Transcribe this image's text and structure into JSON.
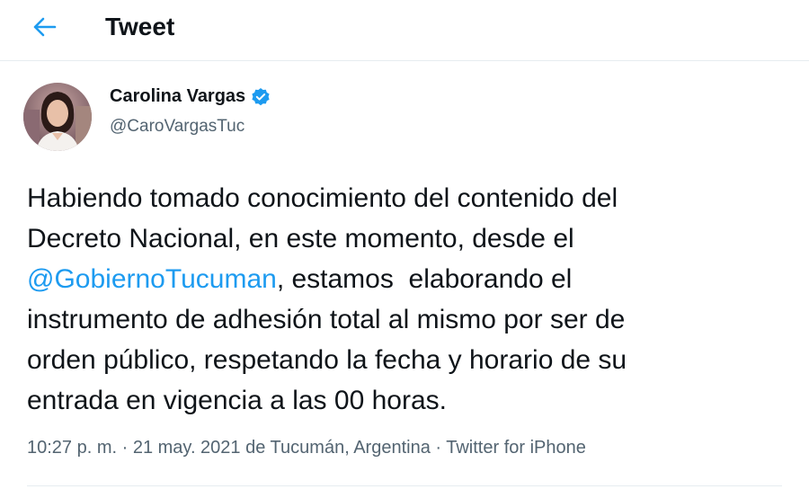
{
  "header": {
    "title": "Tweet",
    "back_icon": "arrow-left-icon"
  },
  "author": {
    "name": "Carolina Vargas",
    "handle": "@CaroVargasTuc",
    "verified": true,
    "verified_icon": "verified-badge-icon"
  },
  "tweet": {
    "text_line_1": "Habiendo tomado conocimiento del contenido del",
    "text_line_2": "Decreto Nacional, en este momento, desde el",
    "mention": "@GobiernoTucuman",
    "text_line_3_rest": ", estamos  elaborando el",
    "text_line_4": "instrumento de adhesión total al mismo por ser de",
    "text_line_5": "orden público, respetando la fecha y horario de su",
    "text_line_6": "entrada en vigencia a las 00 horas."
  },
  "meta": {
    "time": "10:27 p. m.",
    "sep1": " · ",
    "date": "21 may. 2021",
    "location": " de Tucumán, Argentina",
    "sep2": " · ",
    "source": "Twitter for iPhone"
  },
  "colors": {
    "accent": "#1d9bf0",
    "secondary_text": "#536471",
    "divider": "#e6ecf0"
  }
}
